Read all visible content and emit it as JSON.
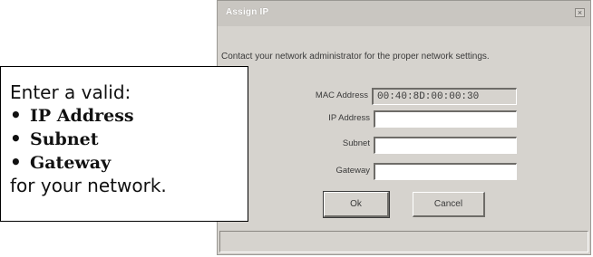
{
  "dialog": {
    "title": "Assign IP",
    "close_glyph": "×",
    "instruction": "Contact your network administrator for the proper network settings.",
    "fields": {
      "mac_label": "MAC Address",
      "mac_value": "00:40:8D:00:00:30",
      "ip_label": "IP Address",
      "ip_value": "",
      "subnet_label": "Subnet",
      "subnet_value": "",
      "gateway_label": "Gateway",
      "gateway_value": ""
    },
    "buttons": {
      "ok_label": "Ok",
      "cancel_label": "Cancel"
    }
  },
  "callout": {
    "intro": "Enter a valid:",
    "bullet_glyph": "•",
    "items": [
      "IP Address",
      "Subnet",
      "Gateway"
    ],
    "outro": "for your network."
  }
}
